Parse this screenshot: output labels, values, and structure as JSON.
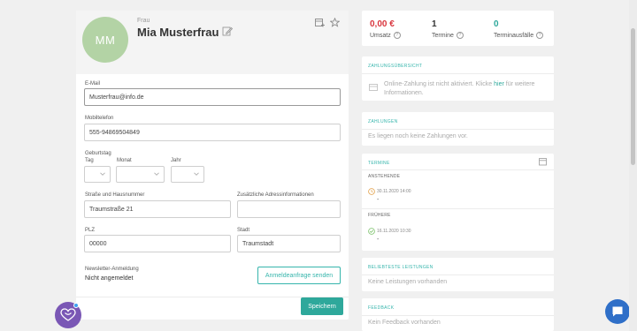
{
  "profile": {
    "initials": "MM",
    "salutation": "Frau",
    "name": "Mia Musterfrau"
  },
  "form": {
    "email_label": "E-Mail",
    "email_value": "Musterfrau@info.de",
    "mobile_label": "Mobiltelefon",
    "mobile_value": "555-94869504849",
    "birthday_label": "Geburtstag",
    "day_label": "Tag",
    "month_label": "Monat",
    "year_label": "Jahr",
    "street_label": "Straße und Hausnummer",
    "street_value": "Traumstraße 21",
    "extra_address_label": "Zusätzliche Adressinformationen",
    "extra_address_value": "",
    "zip_label": "PLZ",
    "zip_value": "00000",
    "city_label": "Stadt",
    "city_value": "Traumstadt",
    "newsletter_label": "Newsletter-Anmeldung",
    "newsletter_status": "Nicht angemeldet",
    "newsletter_button": "Anmeldeanfrage senden",
    "save_button": "Speichern"
  },
  "stats": [
    {
      "value": "0,00 €",
      "label": "Umsatz",
      "color": "#d9363e"
    },
    {
      "value": "1",
      "label": "Termine",
      "color": "#333333"
    },
    {
      "value": "0",
      "label": "Terminausfälle",
      "color": "#2ea89b"
    }
  ],
  "payment_overview": {
    "title": "ZAHLUNGSÜBERSICHT",
    "text_before": "Online-Zahlung ist nicht aktiviert. Klicke",
    "link": "hier",
    "text_after": "für weitere Informationen."
  },
  "payments": {
    "title": "ZAHLUNGEN",
    "empty": "Es liegen noch keine Zahlungen vor."
  },
  "appointments": {
    "title": "TERMINE",
    "upcoming_label": "ANSTEHENDE",
    "upcoming_date": "30.11.2020 14:00",
    "upcoming_detail": "-",
    "past_label": "FRÜHERE",
    "past_date": "16.11.2020 10:30",
    "past_detail": "-"
  },
  "services": {
    "title": "BELIEBTESTE LEISTUNGEN",
    "empty": "Keine Leistungen vorhanden"
  },
  "feedback": {
    "title": "FEEDBACK",
    "empty": "Kein Feedback vorhanden"
  },
  "colors": {
    "accent": "#2ea89b",
    "avatar": "#b3d3a5",
    "revenue": "#d9363e",
    "chat_left": "#7a57b5",
    "chat_right": "#2f6fc8"
  }
}
